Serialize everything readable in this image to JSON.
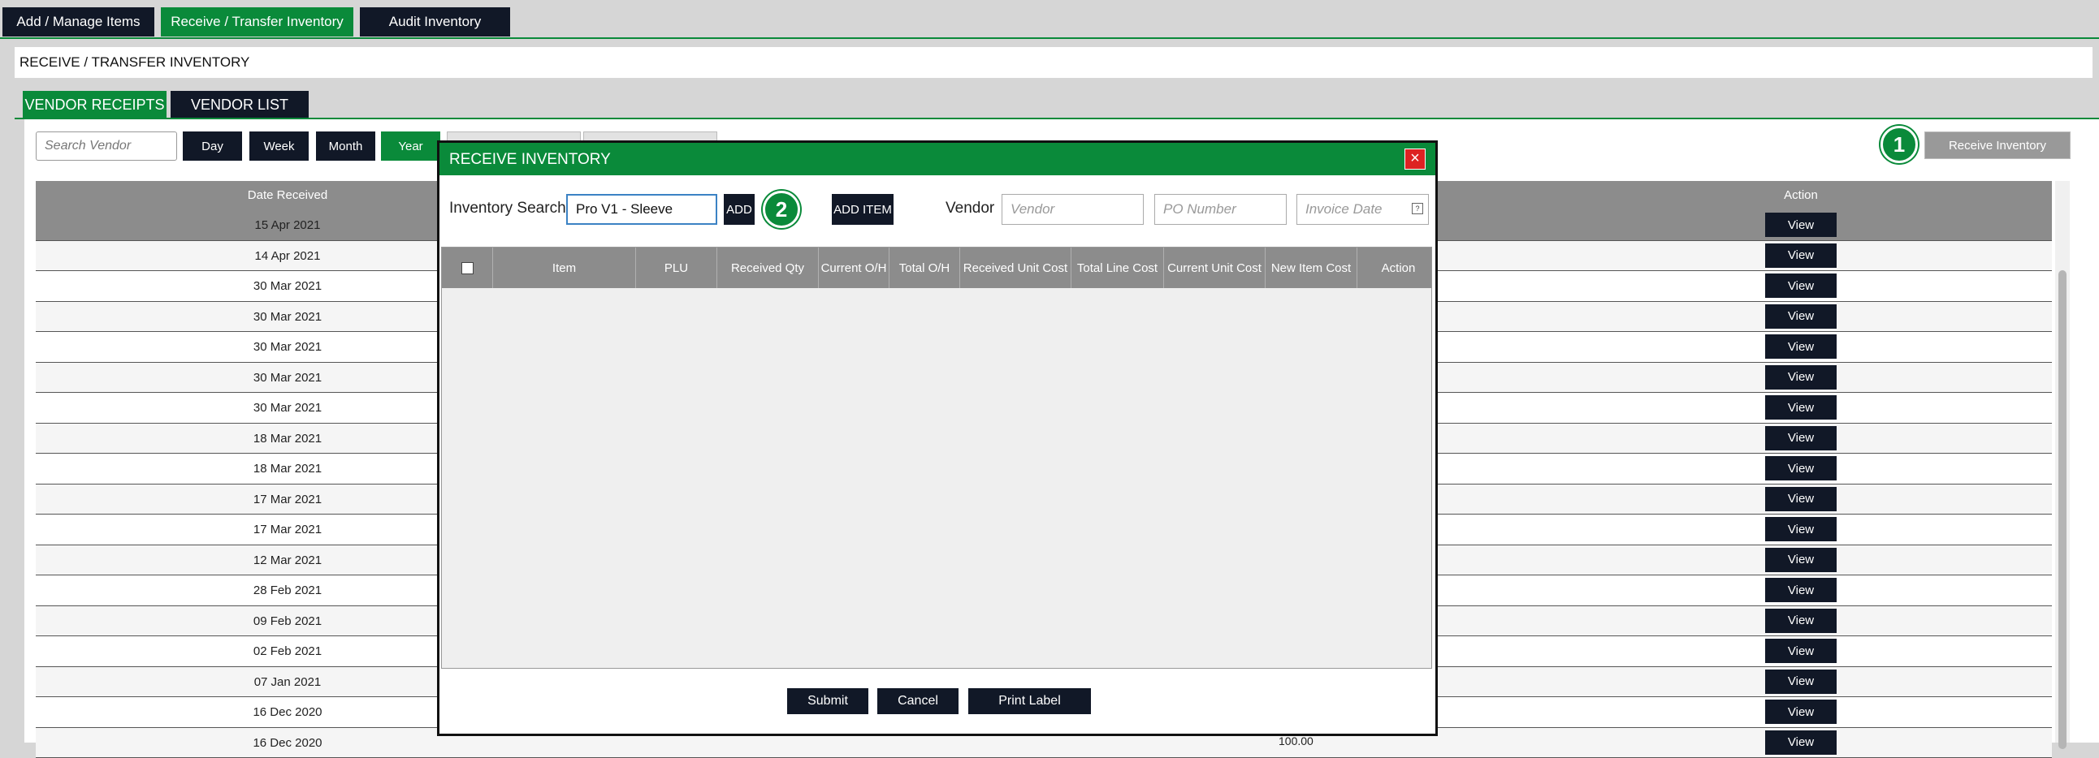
{
  "topnav": {
    "add_manage": "Add / Manage Items",
    "receive_transfer": "Receive / Transfer Inventory",
    "audit": "Audit Inventory"
  },
  "page_title": "RECEIVE / TRANSFER INVENTORY",
  "tabs": {
    "vendor_receipts": "VENDOR RECEIPTS",
    "vendor_list": "VENDOR LIST"
  },
  "filters": {
    "search_placeholder": "Search Vendor",
    "day": "Day",
    "week": "Week",
    "month": "Month",
    "year": "Year"
  },
  "receive_inventory_button": "Receive Inventory",
  "step_badges": [
    "1",
    "2"
  ],
  "table": {
    "col_date": "Date Received",
    "col_action": "Action",
    "view_label": "View",
    "rows": [
      "15 Apr 2021",
      "14 Apr 2021",
      "30 Mar 2021",
      "30 Mar 2021",
      "30 Mar 2021",
      "30 Mar 2021",
      "30 Mar 2021",
      "18 Mar 2021",
      "18 Mar 2021",
      "17 Mar 2021",
      "17 Mar 2021",
      "12 Mar 2021",
      "28 Feb 2021",
      "09 Feb 2021",
      "02 Feb 2021",
      "07 Jan 2021",
      "16 Dec 2020",
      "16 Dec 2020"
    ],
    "partial_value": "100.00"
  },
  "modal": {
    "title": "RECEIVE INVENTORY",
    "close_icon": "close-icon",
    "inventory_search_label": "Inventory Search",
    "inventory_search_value": "Pro V1 - Sleeve",
    "add_button": "ADD",
    "add_item_button": "ADD ITEM",
    "vendor_label": "Vendor",
    "vendor_placeholder": "Vendor",
    "po_placeholder": "PO Number",
    "invoice_placeholder": "Invoice Date",
    "calendar_icon": "calendar-icon",
    "columns": [
      "Item",
      "PLU",
      "Received Qty",
      "Current O/H",
      "Total O/H",
      "Received Unit Cost",
      "Total Line Cost",
      "Current Unit Cost",
      "New Item Cost",
      "Action"
    ],
    "submit": "Submit",
    "cancel": "Cancel",
    "print_label": "Print Label"
  },
  "colors": {
    "accent": "#0a8a3a",
    "dark": "#111827",
    "header_gray": "#8c8c8c",
    "close_red": "#dd2222"
  }
}
